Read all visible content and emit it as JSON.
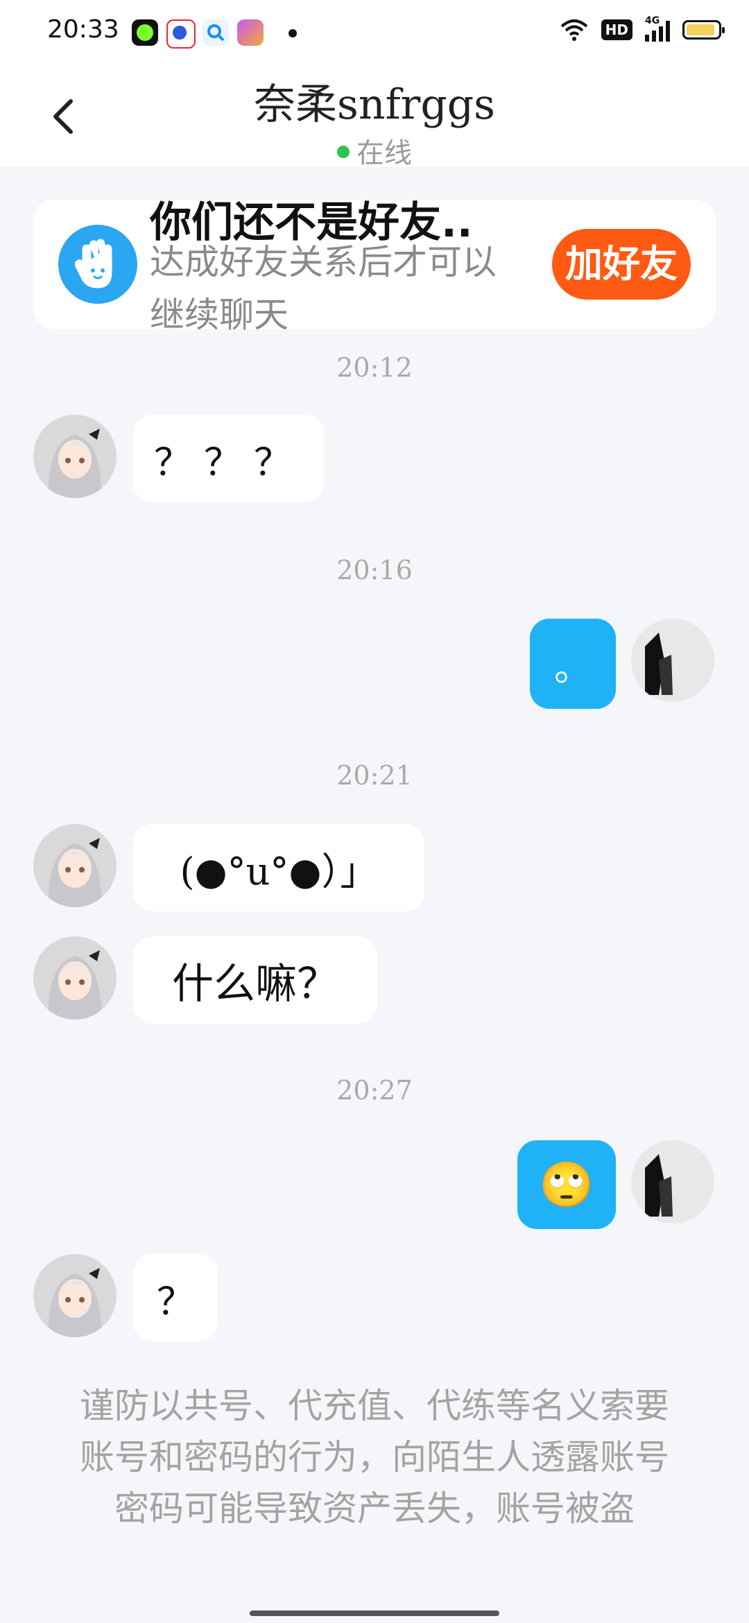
{
  "status_bar": {
    "time": "20:33",
    "network": "4G"
  },
  "header": {
    "title": "奈柔snfrggs",
    "status": "在线",
    "online_color": "#2bc44e"
  },
  "friend_banner": {
    "title": "你们还不是好友..",
    "subtitle": "达成好友关系后才可以继续聊天",
    "button": "加好友",
    "button_color": "#ff5a14"
  },
  "messages": [
    {
      "type": "timestamp",
      "text": "20:12"
    },
    {
      "from": "other",
      "text": "？？？"
    },
    {
      "type": "timestamp",
      "text": "20:16"
    },
    {
      "from": "me",
      "text": "。"
    },
    {
      "type": "timestamp",
      "text": "20:21"
    },
    {
      "from": "other",
      "text": "(●°u°●）」"
    },
    {
      "from": "other",
      "text": "什么嘛？"
    },
    {
      "type": "timestamp",
      "text": "20:27"
    },
    {
      "from": "me",
      "text": "🙄"
    },
    {
      "from": "other",
      "text": "？"
    }
  ],
  "security_notice": "谨防以共号、代充值、代练等名义索要账号和密码的行为，向陌生人透露账号密码可能导致资产丢失，账号被盗",
  "colors": {
    "my_bubble": "#1fb2f7",
    "background": "#f4f6f9"
  }
}
